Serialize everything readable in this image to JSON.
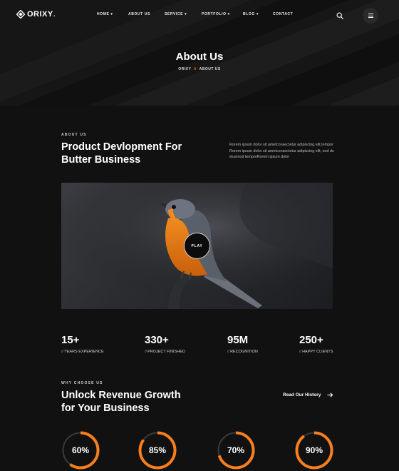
{
  "header": {
    "logo_text": "ORIXY",
    "logo_dot": ".",
    "nav": [
      {
        "label": "HOME",
        "has_dropdown": true
      },
      {
        "label": "ABOUT US",
        "has_dropdown": false
      },
      {
        "label": "SERVICE",
        "has_dropdown": true
      },
      {
        "label": "PORTFOLIO",
        "has_dropdown": true
      },
      {
        "label": "BLOG",
        "has_dropdown": true
      },
      {
        "label": "CONTACT",
        "has_dropdown": false
      }
    ],
    "chevron": "▾",
    "search_icon": "search-icon",
    "menu_icon": "hamburger-icon"
  },
  "hero": {
    "title": "About Us",
    "breadcrumb": {
      "home": "ORIXY",
      "separator": "//",
      "current": "ABOUT US"
    }
  },
  "about": {
    "tag": "ABOUT US",
    "heading_line1": "Product Devlopment For",
    "heading_line2": "Butter Business",
    "text": "Rorem ipsum dolor sit ametconsectetur adipiscing elit,tempor Rorem ipsum dolor sit ametconsectetur adipiscing elit, sed do eiusmod temporRorem ipsum dolor",
    "play_label": "PLAY"
  },
  "stats": [
    {
      "value": "15+",
      "label": "YEARS EXPERIENCE"
    },
    {
      "value": "330+",
      "label": "PROJECT FINISHED"
    },
    {
      "value": "95M",
      "label": "RECOGNITION"
    },
    {
      "value": "250+",
      "label": "HAPPY CLIENTS"
    }
  ],
  "stat_hash": "//",
  "why": {
    "tag": "WHY CHOOSE US",
    "heading_line1": "Unlock Revenue Growth",
    "heading_line2": "for Your Business",
    "link_label": "Read Our History"
  },
  "progress": [
    {
      "label": "60%",
      "value": 0.6
    },
    {
      "label": "85%",
      "value": 0.85
    },
    {
      "label": "70%",
      "value": 0.7
    },
    {
      "label": "90%",
      "value": 0.9
    }
  ],
  "colors": {
    "accent": "#f77f1d",
    "background": "#111111",
    "track": "#3a3a3a"
  }
}
